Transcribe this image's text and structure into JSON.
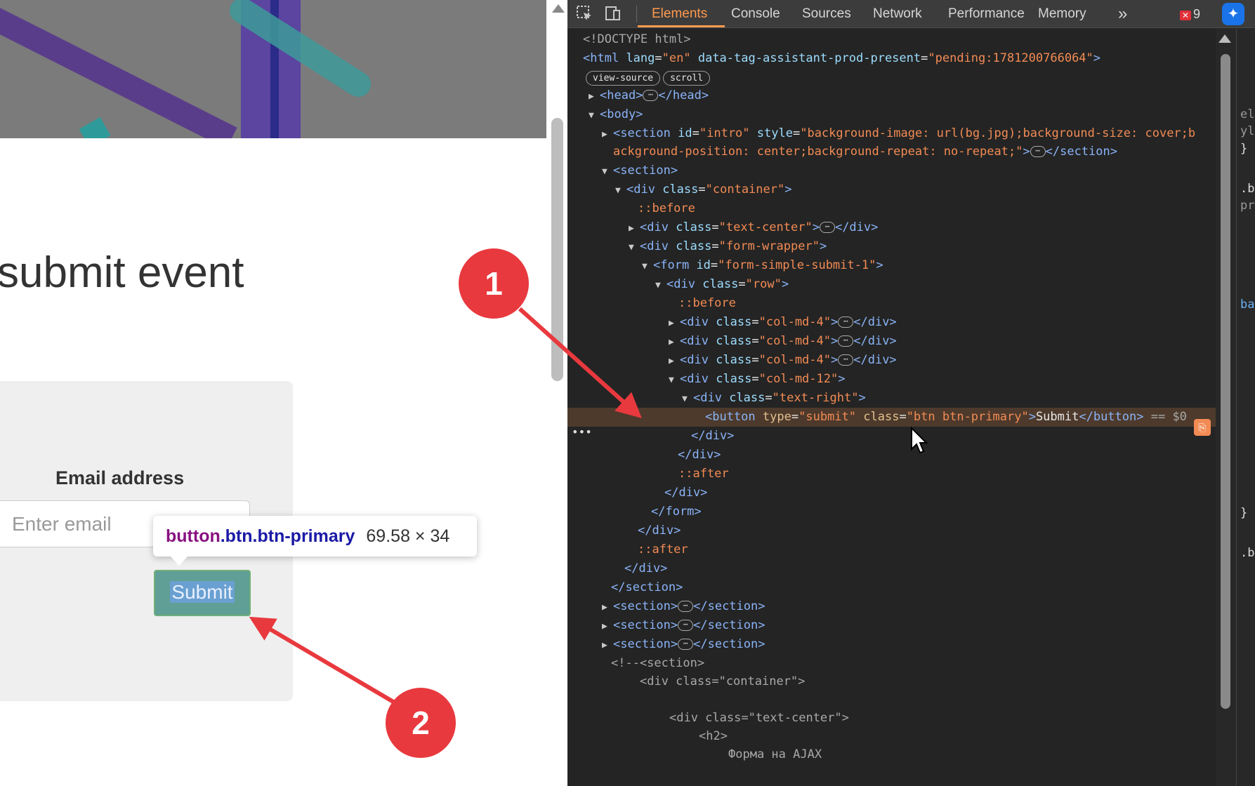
{
  "page": {
    "heading": "submit event",
    "email_label": "Email address",
    "email_placeholder": "Enter email",
    "submit_label": "Submit"
  },
  "tooltip": {
    "tag": "button",
    "classes": ".btn.btn-primary",
    "size": "69.58 × 34"
  },
  "devtools": {
    "tabs": [
      "Elements",
      "Console",
      "Sources",
      "Network",
      "Performance",
      "Memory"
    ],
    "active_tab": "Elements",
    "more_tabs": "»",
    "error_count": "9",
    "pills": [
      "view-source",
      "scroll"
    ]
  },
  "dom": {
    "doctype": "<!DOCTYPE html>",
    "html_attr_lang": "\"en\"",
    "html_attr_tag_value": "\"pending:1781200766064\"",
    "intro_style_1": "\"background-image: url(bg.jpg);background-size: cover;b",
    "intro_style_2": "ackground-position: center;background-repeat: no-repeat;\"",
    "comment_1": "<!--<section>",
    "comment_2": "<div class=\"container\">",
    "comment_3": "<div class=\"text-center\">",
    "comment_4": "<h2>",
    "comment_5": "Форма на AJAX"
  },
  "styles_strip": [
    "el",
    "yl",
    "}",
    ".b",
    "pr",
    "ba",
    "}",
    ".b"
  ],
  "annotations": [
    "1",
    "2"
  ],
  "colors": {
    "accent": "#ff9a4d",
    "badge": "#e8393e",
    "button": "#5f9f95"
  }
}
